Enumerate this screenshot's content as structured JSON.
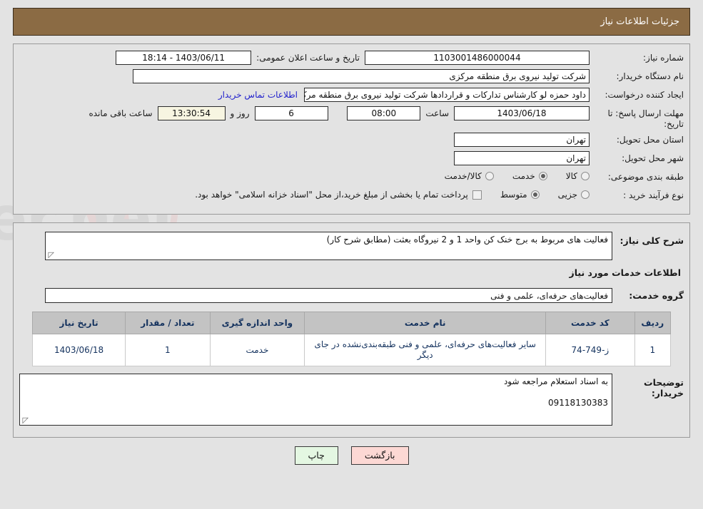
{
  "header": {
    "title": "جزئیات اطلاعات نیاز"
  },
  "top_form": {
    "need_number": {
      "label": "شماره نیاز:",
      "value": "1103001486000044"
    },
    "announce_datetime": {
      "label": "تاریخ و ساعت اعلان عمومی:",
      "value": "1403/06/11 - 18:14"
    },
    "buyer_org": {
      "label": "نام دستگاه خریدار:",
      "value": "شرکت تولید نیروی برق منطقه مرکزی"
    },
    "creator": {
      "label": "ایجاد کننده درخواست:",
      "value": "داود حمزه لو کارشناس تدارکات و قراردادها شرکت تولید نیروی برق منطقه مرکزی",
      "contact_link": "اطلاعات تماس خریدار"
    },
    "deadline": {
      "label": "مهلت ارسال پاسخ: تا تاریخ:",
      "date": "1403/06/18",
      "time_label": "ساعت",
      "time": "08:00",
      "days": "6",
      "days_label": "روز و",
      "countdown": "13:30:54",
      "countdown_label": "ساعت باقی مانده"
    },
    "province": {
      "label": "استان محل تحویل:",
      "value": "تهران"
    },
    "city": {
      "label": "شهر محل تحویل:",
      "value": "تهران"
    },
    "category": {
      "label": "طبقه بندی موضوعی:",
      "options": [
        {
          "label": "کالا",
          "selected": false
        },
        {
          "label": "خدمت",
          "selected": true
        },
        {
          "label": "کالا/خدمت",
          "selected": false
        }
      ]
    },
    "purchase_type": {
      "label": "نوع فرآیند خرید :",
      "options": [
        {
          "label": "جزیی",
          "selected": false
        },
        {
          "label": "متوسط",
          "selected": true
        }
      ],
      "treasury_note": "پرداخت تمام یا بخشی از مبلغ خرید،از محل \"اسناد خزانه اسلامی\" خواهد بود.",
      "treasury_checked": false
    }
  },
  "bottom_form": {
    "overall_desc": {
      "label": "شرح کلی نیاز:",
      "value": "فعالیت های مربوط به برج خنک کن واحد 1 و 2 نیروگاه بعثت (مطابق شرح کار)"
    },
    "services_section_title": "اطلاعات خدمات مورد نیاز",
    "service_group": {
      "label": "گروه خدمت:",
      "value": "فعالیت‌های حرفه‌ای، علمی و فنی"
    },
    "table": {
      "columns": [
        "ردیف",
        "کد خدمت",
        "نام خدمت",
        "واحد اندازه گیری",
        "تعداد / مقدار",
        "تاریخ نیاز"
      ],
      "rows": [
        {
          "radif": "1",
          "code": "ز-749-74",
          "name": "سایر فعالیت‌های حرفه‌ای، علمی و فنی طبقه‌بندی‌نشده در جای دیگر",
          "unit": "خدمت",
          "qty": "1",
          "date": "1403/06/18"
        }
      ]
    },
    "buyer_notes": {
      "label": "توضیحات خریدار:",
      "line1": "به اسناد استعلام مراجعه شود",
      "line2": "09118130383"
    }
  },
  "footer": {
    "print_button": "چاپ",
    "back_button": "بازگشت"
  },
  "colors": {
    "header_bg": "#8b6b44",
    "page_bg": "#e3e3e3",
    "link": "#2222cc",
    "table_header_bg": "#c3c3c3",
    "table_text": "#14325e",
    "print_btn_bg": "#e4f7e2",
    "back_btn_bg": "#fcd8d4",
    "countdown_bg": "#f7f5e1"
  }
}
